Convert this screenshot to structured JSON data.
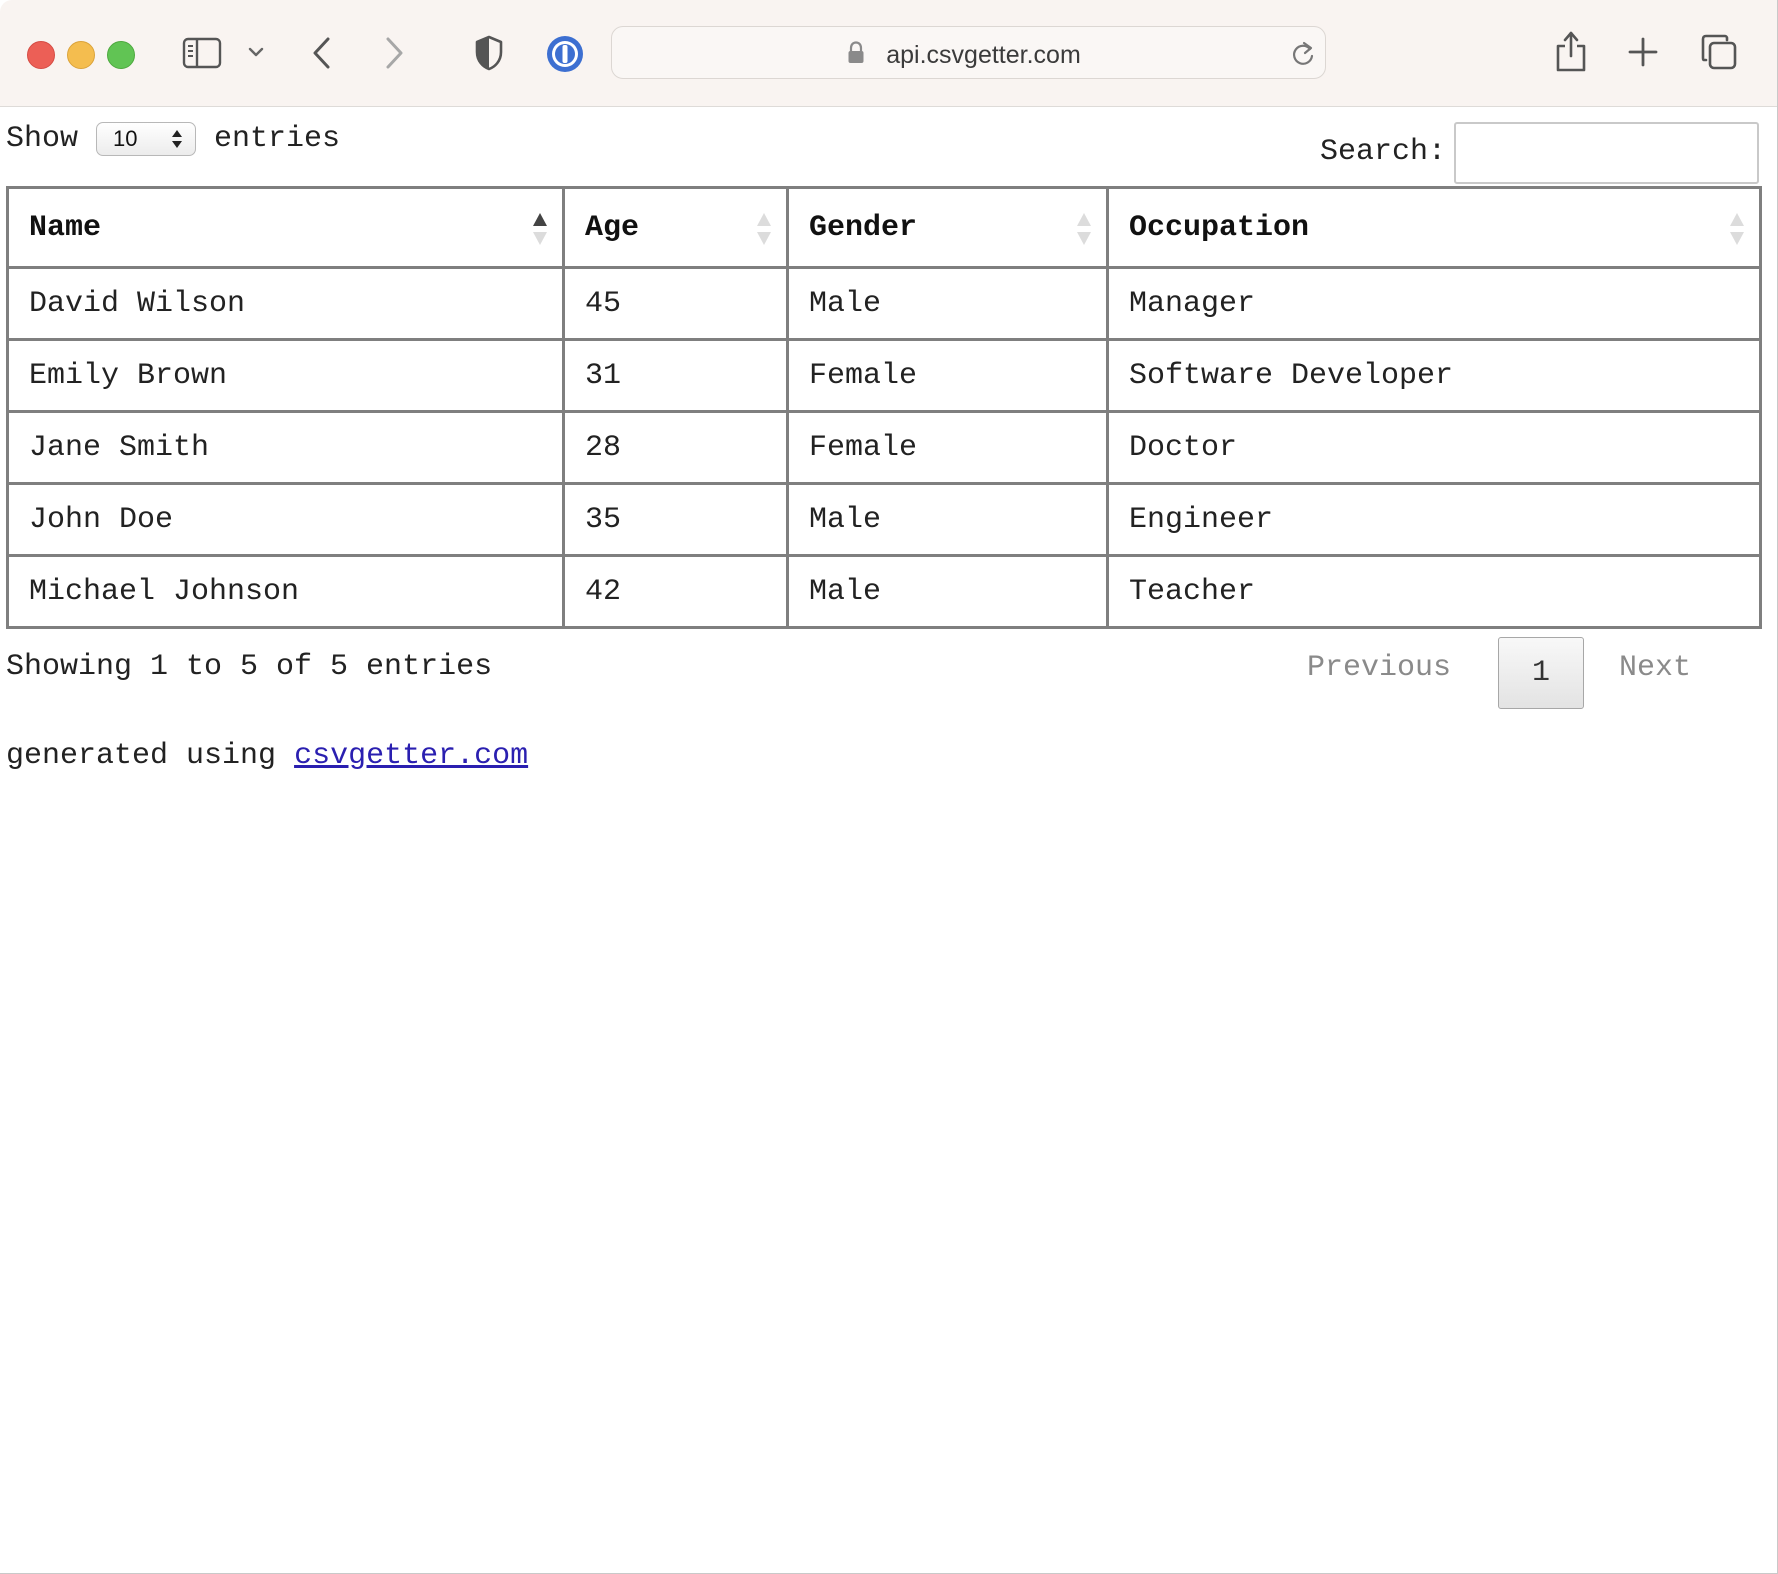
{
  "browser": {
    "url": "api.csvgetter.com"
  },
  "controls": {
    "show_label": "Show",
    "page_length": "10",
    "entries_label": "entries",
    "search_label": "Search:",
    "search_value": ""
  },
  "table": {
    "columns": [
      "Name",
      "Age",
      "Gender",
      "Occupation"
    ],
    "rows": [
      [
        "David Wilson",
        "45",
        "Male",
        "Manager"
      ],
      [
        "Emily Brown",
        "31",
        "Female",
        "Software Developer"
      ],
      [
        "Jane Smith",
        "28",
        "Female",
        "Doctor"
      ],
      [
        "John Doe",
        "35",
        "Male",
        "Engineer"
      ],
      [
        "Michael Johnson",
        "42",
        "Male",
        "Teacher"
      ]
    ]
  },
  "footer": {
    "info": "Showing 1 to 5 of 5 entries",
    "previous_label": "Previous",
    "current_page": "1",
    "next_label": "Next",
    "generated_text": "generated using",
    "generated_link": "csvgetter.com"
  },
  "colors": {
    "close": "#ec5f56",
    "minimize": "#f4bd4f",
    "maximize": "#61c454",
    "link": "#2a1fb0"
  }
}
